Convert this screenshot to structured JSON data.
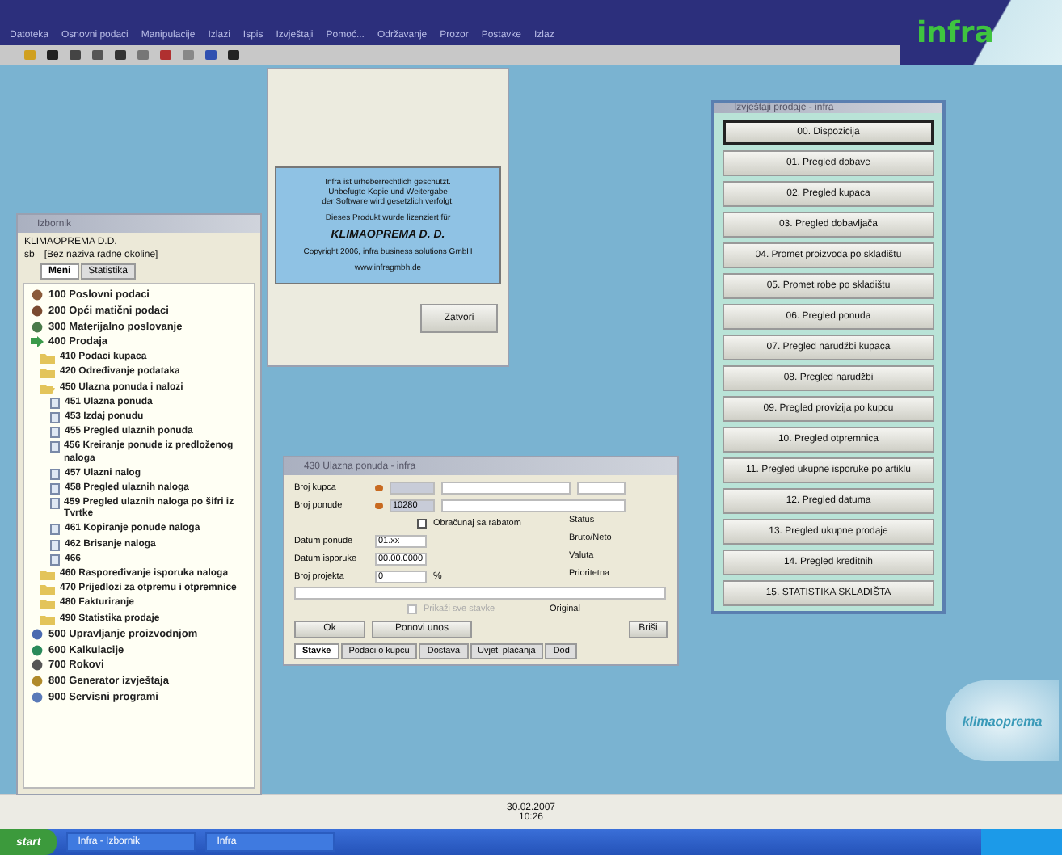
{
  "app": {
    "menu": [
      "Datoteka",
      "Osnovni podaci",
      "Manipulacije",
      "Izlazi",
      "Ispis",
      "Izvještaji",
      "Pomoć...",
      "Održavanje",
      "Prozor",
      "Postavke",
      "Izlaz"
    ],
    "logo": "infra"
  },
  "tree_window": {
    "title": "Izbornik",
    "company": "KLIMAOPREMA D.D.",
    "context": "[Bez naziva radne okoline]",
    "context_prefix": "sb",
    "tabs": [
      {
        "label": "Meni",
        "selected": true
      },
      {
        "label": "Statistika",
        "selected": false
      }
    ],
    "items": [
      {
        "kind": "module",
        "label": "100 Poslovni podaci"
      },
      {
        "kind": "module",
        "label": "200 Opći matični podaci"
      },
      {
        "kind": "module",
        "label": "300 Materijalno poslovanje"
      },
      {
        "kind": "module",
        "label": "400 Prodaja",
        "expanded": true,
        "children": [
          {
            "kind": "folder",
            "label": "410 Podaci kupaca"
          },
          {
            "kind": "folder",
            "label": "420 Određivanje podataka"
          },
          {
            "kind": "folder",
            "label": "450 Ulazna ponuda i nalozi",
            "expanded": true,
            "children": [
              {
                "kind": "doc",
                "label": "451 Ulazna ponuda"
              },
              {
                "kind": "doc",
                "label": "453 Izdaj ponudu"
              },
              {
                "kind": "doc",
                "label": "455 Pregled ulaznih ponuda"
              },
              {
                "kind": "doc",
                "label": "456 Kreiranje ponude iz predloženog naloga"
              },
              {
                "kind": "doc",
                "label": "457 Ulazni nalog"
              },
              {
                "kind": "doc",
                "label": "458 Pregled ulaznih naloga"
              },
              {
                "kind": "doc",
                "label": "459 Pregled ulaznih naloga po šifri iz Tvrtke"
              },
              {
                "kind": "doc",
                "label": "461 Kopiranje ponude naloga"
              },
              {
                "kind": "doc",
                "label": "462 Brisanje naloga"
              },
              {
                "kind": "doc",
                "label": "466"
              }
            ]
          },
          {
            "kind": "folder",
            "label": "460 Raspoređivanje isporuka naloga"
          },
          {
            "kind": "folder",
            "label": "470 Prijedlozi za otpremu i otpremnice"
          },
          {
            "kind": "folder",
            "label": "480 Fakturiranje"
          },
          {
            "kind": "folder",
            "label": "490 Statistika prodaje"
          }
        ]
      },
      {
        "kind": "module",
        "label": "500 Upravljanje proizvodnjom"
      },
      {
        "kind": "module",
        "label": "600 Kalkulacije"
      },
      {
        "kind": "module",
        "label": "700 Rokovi"
      },
      {
        "kind": "module",
        "label": "800 Generator izvještaja"
      },
      {
        "kind": "module",
        "label": "900 Servisni programi"
      }
    ]
  },
  "about_dialog": {
    "lines": [
      "Infra ist urheberrechtlich geschützt.",
      "Unbefugte Kopie und Weitergabe",
      "der Software wird gesetzlich verfolgt."
    ],
    "licensed_for": "Dieses Produkt wurde lizenziert für",
    "licensee": "KLIMAOPREMA D. D.",
    "copyright": "Copyright 2006, infra business solutions GmbH",
    "website": "www.infragmbh.de",
    "button": "Zatvori"
  },
  "offer_dialog": {
    "title": "430 Ulazna ponuda - infra",
    "customer_label": "Broj kupca",
    "offer_label": "Broj ponude",
    "offer_value": "10280",
    "checkbox": {
      "label": "Obračunaj sa rabatom",
      "checked": false
    },
    "date_label": "Datum ponude",
    "date_value": "01.xx",
    "delivery_label": "Datum isporuke",
    "delivery_value": "00.00.0000",
    "project_label": "Broj projekta",
    "project_value": "0",
    "percent": "%",
    "status_labels": [
      "Status",
      "Bruto/Neto",
      "Valuta",
      "Prioritetna"
    ],
    "disabled_checkbox": {
      "label": "Prikaži sve stavke",
      "checked": false
    },
    "original": "Original",
    "buttons": [
      "Ok",
      "Ponovi unos",
      "Briši"
    ],
    "tabs": [
      {
        "label": "Stavke",
        "selected": true
      },
      {
        "label": "Podaci o kupcu",
        "selected": false
      },
      {
        "label": "Dostava",
        "selected": false
      },
      {
        "label": "Uvjeti plaćanja",
        "selected": false
      },
      {
        "label": "Dod",
        "selected": false
      }
    ]
  },
  "reports_window": {
    "title": "Izvještaji prodaje - infra",
    "buttons": [
      {
        "label": "00. Dispozicija",
        "selected": true
      },
      {
        "label": "01. Pregled dobave",
        "selected": false
      },
      {
        "label": "02. Pregled kupaca",
        "selected": false
      },
      {
        "label": "03. Pregled dobavljača",
        "selected": false
      },
      {
        "label": "04. Promet proizvoda po skladištu",
        "selected": false
      },
      {
        "label": "05. Promet robe po skladištu",
        "selected": false
      },
      {
        "label": "06. Pregled ponuda",
        "selected": false
      },
      {
        "label": "07. Pregled narudžbi kupaca",
        "selected": false
      },
      {
        "label": "08. Pregled narudžbi",
        "selected": false
      },
      {
        "label": "09. Pregled provizija po kupcu",
        "selected": false
      },
      {
        "label": "10. Pregled otpremnica",
        "selected": false
      },
      {
        "label": "11. Pregled ukupne isporuke po artiklu",
        "selected": false
      },
      {
        "label": "12. Pregled datuma",
        "selected": false
      },
      {
        "label": "13. Pregled ukupne prodaje",
        "selected": false
      },
      {
        "label": "14. Pregled kreditnih",
        "selected": false
      },
      {
        "label": "15. STATISTIKA SKLADIŠTA",
        "selected": false
      }
    ]
  },
  "corner_logo": "klimaoprema",
  "status_bar": {
    "date": "30.02.2007",
    "time": "10:26"
  },
  "taskbar": {
    "start": "start",
    "tasks": [
      "Infra - Izbornik",
      "Infra"
    ]
  }
}
